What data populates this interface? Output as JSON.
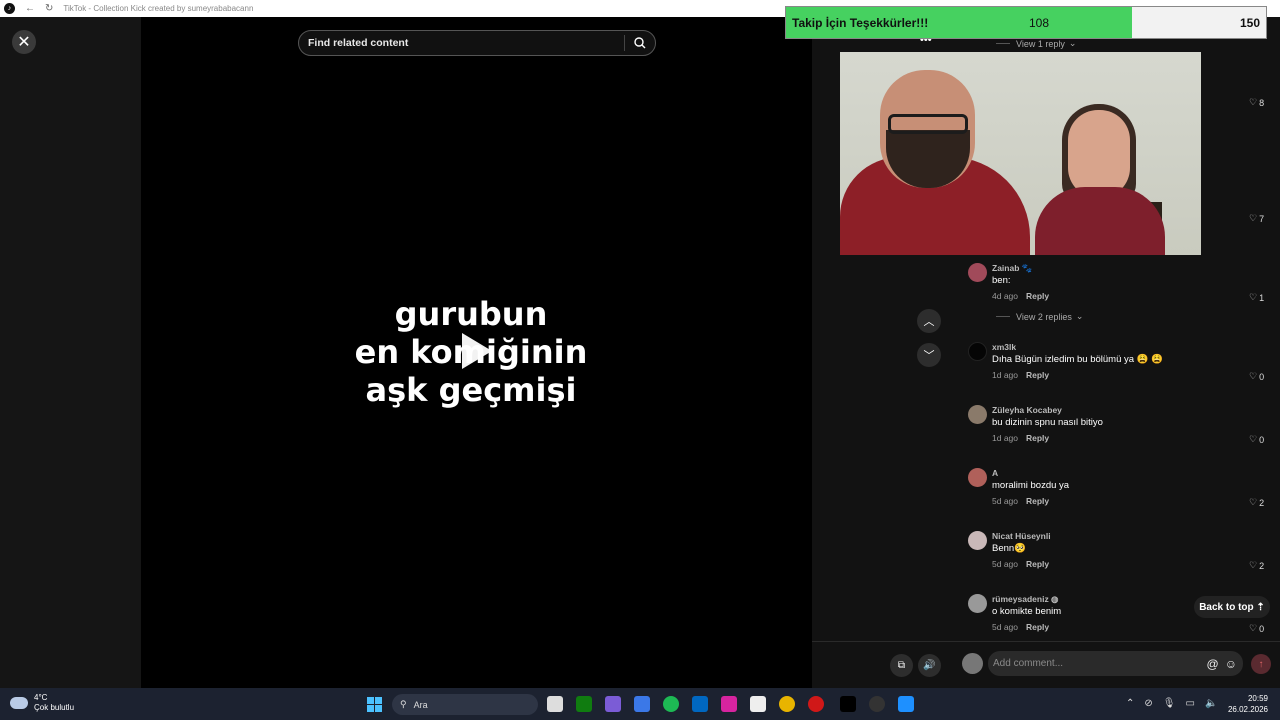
{
  "window": {
    "title": "TikTok - Collection Kick created by sumeyrababacann"
  },
  "search": {
    "placeholder": "Find related content"
  },
  "video": {
    "caption_lines": [
      "gurubun",
      "en komiğinin",
      "aşk geçmişi"
    ]
  },
  "follow_goal": {
    "label": "Takip İçin Teşekkürler!!!",
    "current": "108",
    "goal": "150",
    "progress": 0.72
  },
  "replies": {
    "top": "View 1 reply",
    "zainab": "View 2 replies"
  },
  "likes_upper": [
    "8",
    "7"
  ],
  "comments": [
    {
      "user": "Zainab 🐾",
      "text": "ben:",
      "time": "4d ago",
      "reply": "Reply",
      "likes": "1",
      "avatar_color": "#a14a5a"
    },
    {
      "user": "xm3lk",
      "text": "Dıha Bügün izledim bu bölümü ya 😩 😩",
      "time": "1d ago",
      "reply": "Reply",
      "likes": "0",
      "avatar_color": "#050505"
    },
    {
      "user": "Züleyha Kocabey",
      "text": "bu dizinin spnu nasıl bitiyo",
      "time": "1d ago",
      "reply": "Reply",
      "likes": "0",
      "avatar_color": "#8a7a6a"
    },
    {
      "user": "A",
      "text": "moralimi bozdu ya",
      "time": "5d ago",
      "reply": "Reply",
      "likes": "2",
      "avatar_color": "#b0605a"
    },
    {
      "user": "Nicat Hüseynli",
      "text": "Benn🥺",
      "time": "5d ago",
      "reply": "Reply",
      "likes": "2",
      "avatar_color": "#c9b8b8"
    },
    {
      "user": "rümeysadeniz ◍",
      "text": "o komikte benim",
      "time": "5d ago",
      "reply": "Reply",
      "likes": "0",
      "avatar_color": "#999999"
    }
  ],
  "back_to_top": "Back to top ⇡",
  "comment_box": {
    "placeholder": "Add comment..."
  },
  "taskbar": {
    "temp": "4°C",
    "weather": "Çok bulutlu",
    "search": "Ara",
    "time": "20:59",
    "date": "26.02.2026"
  }
}
